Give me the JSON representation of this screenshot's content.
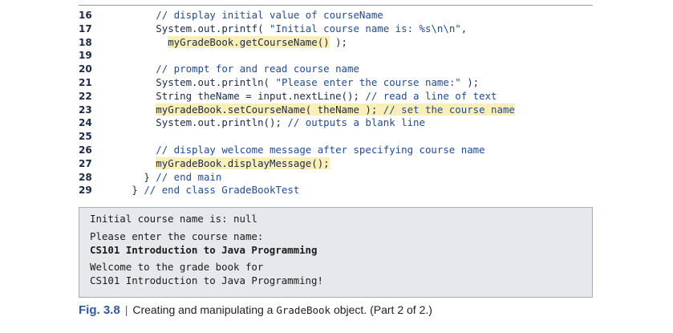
{
  "code_lines": [
    {
      "num": "16",
      "indent": 7,
      "segs": [
        {
          "t": "// display initial value of courseName",
          "c": "comment"
        }
      ]
    },
    {
      "num": "17",
      "indent": 7,
      "segs": [
        {
          "t": "System.out.printf( ",
          "c": "normal"
        },
        {
          "t": "\"Initial course name is: %s\\n\\n\"",
          "c": "string"
        },
        {
          "t": ",",
          "c": "normal"
        }
      ]
    },
    {
      "num": "18",
      "indent": 9,
      "segs": [
        {
          "t": "myGradeBook.getCourseName()",
          "c": "normal",
          "hl": true
        },
        {
          "t": " );",
          "c": "normal"
        }
      ]
    },
    {
      "num": "19",
      "indent": 0,
      "segs": []
    },
    {
      "num": "20",
      "indent": 7,
      "segs": [
        {
          "t": "// prompt for and read course name",
          "c": "comment"
        }
      ]
    },
    {
      "num": "21",
      "indent": 7,
      "segs": [
        {
          "t": "System.out.println( ",
          "c": "normal"
        },
        {
          "t": "\"Please enter the course name:\"",
          "c": "string"
        },
        {
          "t": " );",
          "c": "normal"
        }
      ]
    },
    {
      "num": "22",
      "indent": 7,
      "segs": [
        {
          "t": "String theName = input.nextLine(); ",
          "c": "normal"
        },
        {
          "t": "// read a line of text",
          "c": "comment"
        }
      ]
    },
    {
      "num": "23",
      "indent": 7,
      "segs": [
        {
          "t": "myGradeBook.setCourseName( theName ); ",
          "c": "normal",
          "hl": true
        },
        {
          "t": "// set the course name",
          "c": "comment",
          "hl": true
        }
      ]
    },
    {
      "num": "24",
      "indent": 7,
      "segs": [
        {
          "t": "System.out.println(); ",
          "c": "normal"
        },
        {
          "t": "// outputs a blank line",
          "c": "comment"
        }
      ]
    },
    {
      "num": "25",
      "indent": 0,
      "segs": []
    },
    {
      "num": "26",
      "indent": 7,
      "segs": [
        {
          "t": "// display welcome message after specifying course name",
          "c": "comment"
        }
      ]
    },
    {
      "num": "27",
      "indent": 7,
      "segs": [
        {
          "t": "myGradeBook.displayMessage();",
          "c": "normal",
          "hl": true
        }
      ]
    },
    {
      "num": "28",
      "indent": 5,
      "segs": [
        {
          "t": "} ",
          "c": "normal"
        },
        {
          "t": "// end main",
          "c": "comment"
        }
      ]
    },
    {
      "num": "29",
      "indent": 3,
      "segs": [
        {
          "t": "} ",
          "c": "normal"
        },
        {
          "t": "// end class GradeBookTest",
          "c": "comment"
        }
      ]
    }
  ],
  "output": {
    "line1": "Initial course name is: null",
    "line2": "Please enter the course name:",
    "line3": "CS101 Introduction to Java Programming",
    "line4": "Welcome to the grade book for",
    "line5": "CS101 Introduction to Java Programming!"
  },
  "caption": {
    "label": "Fig. 3.8",
    "separator": "|",
    "text_before": "Creating and manipulating a ",
    "code": "GradeBook",
    "text_after": " object. (Part 2 of 2.)"
  },
  "colors": {
    "comment": "#1f4b99",
    "highlight": "#fbefb8",
    "output_bg": "#e7e8ec",
    "fig_label": "#2b5aa6"
  }
}
